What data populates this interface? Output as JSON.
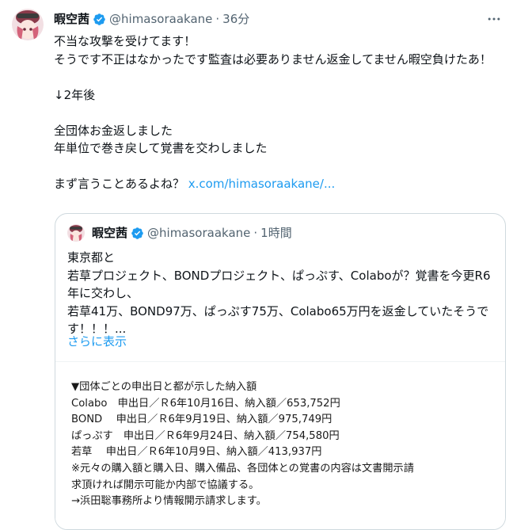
{
  "tweet": {
    "author_name": "暇空茜",
    "handle": "@himasoraakane",
    "separator": "·",
    "time": "36分",
    "body_lines": [
      "不当な攻撃を受けてます！",
      "そうです不正はなかったです監査は必要ありません返金してません暇空負けたあ！",
      "",
      "↓2年後",
      "",
      "全団体お金返しました",
      "年単位で巻き戻して覚書を交わしました",
      ""
    ],
    "last_line_text": "まず言うことあるよね？ ",
    "link_text": "x.com/himasoraakane/..."
  },
  "quote": {
    "author_name": "暇空茜",
    "handle": "@himasoraakane",
    "separator": "·",
    "time": "1時間",
    "body": "東京都と\n若草プロジェクト、BONDプロジェクト、ぱっぷす、Colaboが？覚書を今更R6年に交わし、\n若草41万、BOND97万、ぱっぷす75万、Colabo65万円を返金していたそうです！！！...",
    "show_more": "さらに表示",
    "document_text": [
      "▼団体ごとの申出日と都が示した納入額",
      "Colabo　申出日／Ｒ6年10月16日、納入額／653,752円",
      "BOND　 申出日／Ｒ6年9月19日、納入額／975,749円",
      "ぱっぷす　申出日／Ｒ6年9月24日、納入額／754,580円",
      "若草　 申出日／Ｒ6年10月9日、納入額／413,937円",
      "※元々の購入額と購入日、購入備品、各団体との覚書の内容は文書開示請",
      "求頂ければ開示可能か内部で協議する。",
      "→浜田聡事務所より情報開示請求します。"
    ]
  },
  "colors": {
    "text": "#0f1419",
    "secondary": "#536471",
    "link": "#1d9bf0",
    "verified": "#1d9bf0",
    "border": "#cfd9de"
  },
  "icons": {
    "verified": "verified-badge-icon",
    "more": "more-options-icon"
  }
}
